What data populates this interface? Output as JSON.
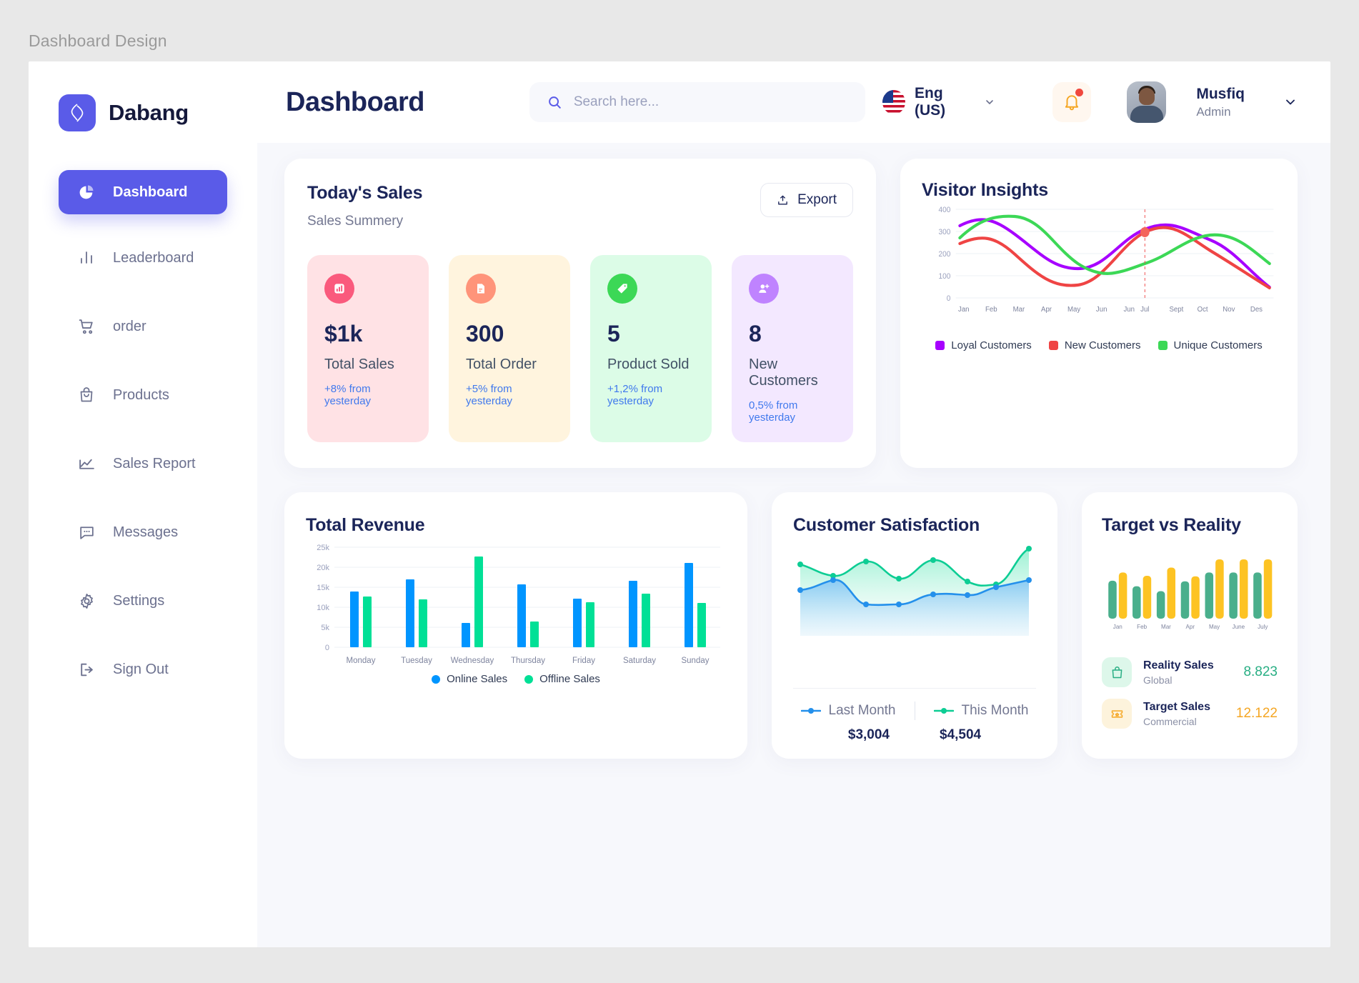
{
  "page_label": "Dashboard Design",
  "brand": {
    "name": "Dabang",
    "logo_icon": "dabang-logo-icon",
    "color": "#5a5be8"
  },
  "sidebar": {
    "items": [
      {
        "label": "Dashboard",
        "icon": "pie-chart-icon",
        "active": true
      },
      {
        "label": "Leaderboard",
        "icon": "bar-chart-icon",
        "active": false
      },
      {
        "label": "order",
        "icon": "cart-icon",
        "active": false
      },
      {
        "label": "Products",
        "icon": "bag-icon",
        "active": false
      },
      {
        "label": "Sales Report",
        "icon": "line-chart-icon",
        "active": false
      },
      {
        "label": "Messages",
        "icon": "message-icon",
        "active": false
      },
      {
        "label": "Settings",
        "icon": "gear-icon",
        "active": false
      },
      {
        "label": "Sign Out",
        "icon": "logout-icon",
        "active": false
      }
    ]
  },
  "header": {
    "title": "Dashboard",
    "search_placeholder": "Search here...",
    "search_value": "",
    "search_icon": "search-icon",
    "language": "Eng (US)",
    "language_flag": "us-flag-icon",
    "notification_icon": "bell-icon",
    "has_notification": true,
    "user_name": "Musfiq",
    "user_role": "Admin"
  },
  "todays_sales": {
    "title": "Today's Sales",
    "subtitle": "Sales Summery",
    "export_label": "Export",
    "export_icon": "export-icon",
    "tiles": [
      {
        "value": "$1k",
        "label": "Total Sales",
        "delta": "+8% from yesterday",
        "bg": "#ffe2e5",
        "icon_bg": "#fa5a7d",
        "icon": "bar-chart-icon"
      },
      {
        "value": "300",
        "label": "Total Order",
        "delta": "+5% from yesterday",
        "bg": "#fff4de",
        "icon_bg": "#ff947a",
        "icon": "document-icon"
      },
      {
        "value": "5",
        "label": "Product Sold",
        "delta": "+1,2% from yesterday",
        "bg": "#dcfce7",
        "icon_bg": "#3cd856",
        "icon": "tag-icon"
      },
      {
        "value": "8",
        "label": "New Customers",
        "delta": "0,5% from yesterday",
        "bg": "#f3e8ff",
        "icon_bg": "#bf83ff",
        "icon": "add-user-icon"
      }
    ]
  },
  "customer_satisfaction": {
    "title": "Customer Satisfaction",
    "legend": [
      {
        "label": "Last Month",
        "value": "$3,004",
        "color": "#2490eb"
      },
      {
        "label": "This Month",
        "value": "$4,504",
        "color": "#0dcd94"
      }
    ]
  },
  "target_vs_reality": {
    "title": "Target vs Reality",
    "rows": [
      {
        "name": "Reality Sales",
        "sub": "Global",
        "value": "8.823",
        "color": "#27ae83",
        "icon": "bag-icon",
        "icon_bg": "#ddf7ea"
      },
      {
        "name": "Target Sales",
        "sub": "Commercial",
        "value": "12.122",
        "color": "#f5a623",
        "icon": "ticket-icon",
        "icon_bg": "#fdf3dc"
      }
    ]
  },
  "chart_data": [
    {
      "type": "line",
      "title": "Visitor Insights",
      "x": [
        "Jan",
        "Feb",
        "Mar",
        "Apr",
        "May",
        "Jun",
        "Jun",
        "Jul",
        "Sept",
        "Oct",
        "Nov",
        "Des"
      ],
      "ylim": [
        0,
        400
      ],
      "yticks": [
        0,
        100,
        200,
        300,
        400
      ],
      "grid": true,
      "legend_position": "bottom",
      "marker": {
        "series": "New Customers",
        "x": "Jul",
        "value": 360
      },
      "series": [
        {
          "name": "Loyal Customers",
          "color": "#a700ff",
          "values": [
            325,
            340,
            295,
            235,
            190,
            200,
            255,
            310,
            320,
            290,
            215,
            140
          ]
        },
        {
          "name": "New Customers",
          "color": "#ef4444",
          "values": [
            245,
            265,
            205,
            145,
            130,
            185,
            275,
            345,
            360,
            305,
            225,
            140
          ]
        },
        {
          "name": "Unique Customers",
          "color": "#3cd856",
          "values": [
            270,
            340,
            360,
            320,
            255,
            210,
            205,
            230,
            290,
            310,
            285,
            200
          ]
        }
      ]
    },
    {
      "type": "bar",
      "title": "Total Revenue",
      "categories": [
        "Monday",
        "Tuesday",
        "Wednesday",
        "Thursday",
        "Friday",
        "Saturday",
        "Sunday"
      ],
      "ylim": [
        0,
        25000
      ],
      "yticks": [
        "0",
        "5k",
        "10k",
        "15k",
        "20k",
        "25k"
      ],
      "grid": true,
      "legend_position": "bottom",
      "series": [
        {
          "name": "Online Sales",
          "color": "#0095ff",
          "values": [
            14000,
            17000,
            6000,
            15700,
            12100,
            16700,
            21000
          ]
        },
        {
          "name": "Offline Sales",
          "color": "#00e096",
          "values": [
            12700,
            11900,
            22700,
            6500,
            11300,
            13500,
            11200
          ]
        }
      ]
    },
    {
      "type": "area",
      "title": "Customer Satisfaction",
      "x": [
        1,
        2,
        3,
        4,
        5,
        6,
        7,
        8,
        9
      ],
      "series": [
        {
          "name": "Last Month",
          "color": "#2490eb",
          "values": [
            46,
            58,
            28,
            28,
            40,
            41,
            39,
            52,
            100
          ]
        },
        {
          "name": "This Month",
          "color": "#0dcd94",
          "values": [
            76,
            66,
            72,
            60,
            78,
            72,
            56,
            82,
            100
          ]
        }
      ]
    },
    {
      "type": "bar",
      "title": "Target vs Reality",
      "categories": [
        "Jan",
        "Feb",
        "Mar",
        "Apr",
        "May",
        "June",
        "July"
      ],
      "series": [
        {
          "name": "Reality Sales",
          "color": "#4aaf8c",
          "values": [
            60,
            51,
            43,
            59,
            73,
            73,
            73
          ]
        },
        {
          "name": "Target Sales",
          "color": "#fdc323",
          "values": [
            74,
            70,
            86,
            70,
            100,
            100,
            100
          ]
        }
      ]
    }
  ]
}
